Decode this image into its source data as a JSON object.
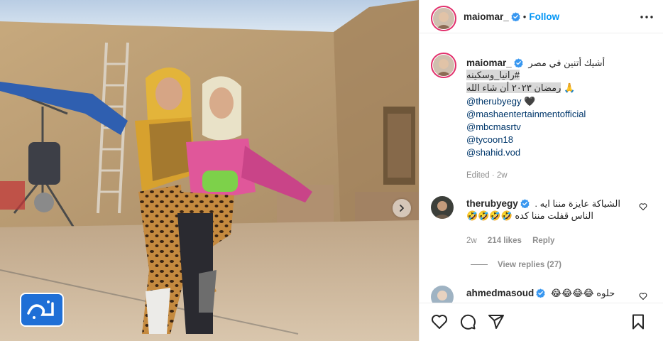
{
  "post": {
    "username": "maiomar_",
    "follow_label": "Follow",
    "separator": "•",
    "caption_line1": "أشيك أتنين في مصر",
    "caption_hashtag": "#رانيا_وسكينه",
    "caption_line3": "رمضان ٢٠٢٣ أن شاء الله",
    "emoji_pray": "🙏",
    "heart": "🖤",
    "mentions": [
      "@therubyegy",
      "@mashaentertainmentofficial",
      "@mbcmasrtv",
      "@tycoon18",
      "@shahid.vod"
    ],
    "edited_label": "Edited",
    "edited_time": "2w"
  },
  "comments": [
    {
      "username": "therubyegy",
      "line1": "الشياكة عايزة مننا ايه .",
      "line2": "الناس قفلت مننا كده",
      "emojis": "🤣🤣🤣🤣",
      "time": "2w",
      "likes": "214 likes",
      "reply_label": "Reply",
      "view_replies": "View replies (27)"
    },
    {
      "username": "ahmedmasoud",
      "text": "حلوه",
      "emojis": "😂😂😂😂"
    }
  ],
  "icons": {
    "verified": "verified-badge-icon",
    "more": "more-options-icon",
    "like": "heart-icon",
    "comment": "comment-icon",
    "share": "send-icon",
    "save": "bookmark-icon",
    "next": "chevron-right-icon"
  },
  "colors": {
    "follow": "#0095f6",
    "verified": "#3897f0",
    "mention": "#00376b",
    "muted": "#8e8e8e"
  }
}
